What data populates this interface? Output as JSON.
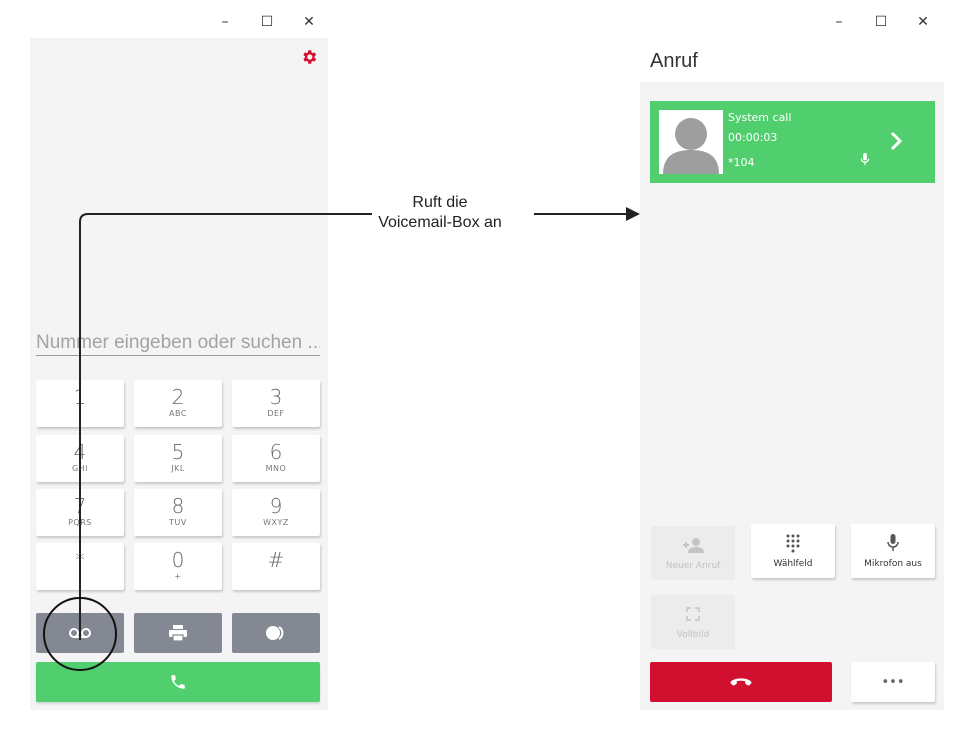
{
  "dialer": {
    "window_controls": {
      "minimize": "–",
      "maximize": "☐",
      "close": "✕"
    },
    "search_placeholder": "Nummer eingeben oder suchen ...",
    "keys": [
      {
        "digit": "1",
        "letters": ""
      },
      {
        "digit": "2",
        "letters": "ABC"
      },
      {
        "digit": "3",
        "letters": "DEF"
      },
      {
        "digit": "4",
        "letters": "GHI"
      },
      {
        "digit": "5",
        "letters": "JKL"
      },
      {
        "digit": "6",
        "letters": "MNO"
      },
      {
        "digit": "7",
        "letters": "PQRS"
      },
      {
        "digit": "8",
        "letters": "TUV"
      },
      {
        "digit": "9",
        "letters": "WXYZ"
      },
      {
        "digit": "*",
        "letters": ""
      },
      {
        "digit": "0",
        "letters": "+"
      },
      {
        "digit": "#",
        "letters": ""
      }
    ],
    "icons": {
      "settings": "gear-icon",
      "voicemail": "voicemail-icon",
      "fax": "printer-icon",
      "toggle": "toggle-icon",
      "call": "phone-icon"
    }
  },
  "annotation": {
    "line1": "Ruft die",
    "line2": "Voicemail-Box an"
  },
  "call": {
    "window_controls": {
      "minimize": "–",
      "maximize": "☐",
      "close": "✕"
    },
    "title": "Anruf",
    "card": {
      "name": "System call",
      "duration": "00:00:03",
      "number": "*104"
    },
    "actions": [
      {
        "label": "Neuer Anruf",
        "enabled": false,
        "icon": "add-person-icon"
      },
      {
        "label": "Wählfeld",
        "enabled": true,
        "icon": "dialpad-icon"
      },
      {
        "label": "Mikrofon aus",
        "enabled": true,
        "icon": "microphone-icon"
      },
      {
        "label": "Vollbild",
        "enabled": false,
        "icon": "fullscreen-icon"
      }
    ],
    "more_label": "•••"
  },
  "colors": {
    "green": "#51cf6f",
    "red": "#d1102f",
    "gear": "#d1102f",
    "gray_button": "#838892"
  }
}
